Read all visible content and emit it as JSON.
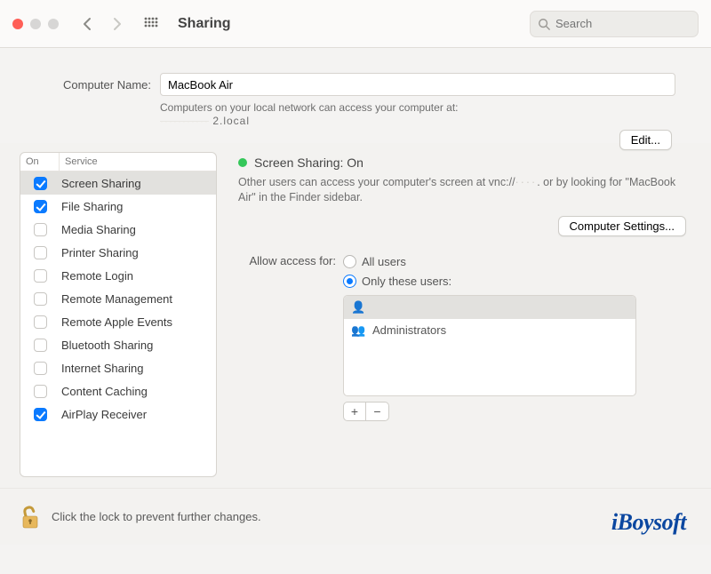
{
  "toolbar": {
    "title": "Sharing",
    "search_placeholder": "Search"
  },
  "computer_name": {
    "label": "Computer Name:",
    "value": "MacBook Air",
    "description": "Computers on your local network can access your computer at:",
    "hostname_suffix": "2.local",
    "edit_button": "Edit..."
  },
  "services": {
    "header_on": "On",
    "header_service": "Service",
    "items": [
      {
        "name": "Screen Sharing",
        "on": true,
        "selected": true
      },
      {
        "name": "File Sharing",
        "on": true,
        "selected": false
      },
      {
        "name": "Media Sharing",
        "on": false,
        "selected": false
      },
      {
        "name": "Printer Sharing",
        "on": false,
        "selected": false
      },
      {
        "name": "Remote Login",
        "on": false,
        "selected": false
      },
      {
        "name": "Remote Management",
        "on": false,
        "selected": false
      },
      {
        "name": "Remote Apple Events",
        "on": false,
        "selected": false
      },
      {
        "name": "Bluetooth Sharing",
        "on": false,
        "selected": false
      },
      {
        "name": "Internet Sharing",
        "on": false,
        "selected": false
      },
      {
        "name": "Content Caching",
        "on": false,
        "selected": false
      },
      {
        "name": "AirPlay Receiver",
        "on": true,
        "selected": false
      }
    ]
  },
  "detail": {
    "status_label": "Screen Sharing: On",
    "description_prefix": "Other users can access your computer's screen at vnc://",
    "description_suffix": ". or by looking for \"MacBook Air\" in the Finder sidebar.",
    "computer_settings_button": "Computer Settings...",
    "access_label": "Allow access for:",
    "radio_all": "All users",
    "radio_only": "Only these users:",
    "users": [
      {
        "name": "",
        "highlight": true
      },
      {
        "name": "Administrators",
        "highlight": false
      }
    ],
    "plus": "+",
    "minus": "−"
  },
  "footer": {
    "lock_text": "Click the lock to prevent further changes.",
    "brand": "iBoysoft"
  }
}
